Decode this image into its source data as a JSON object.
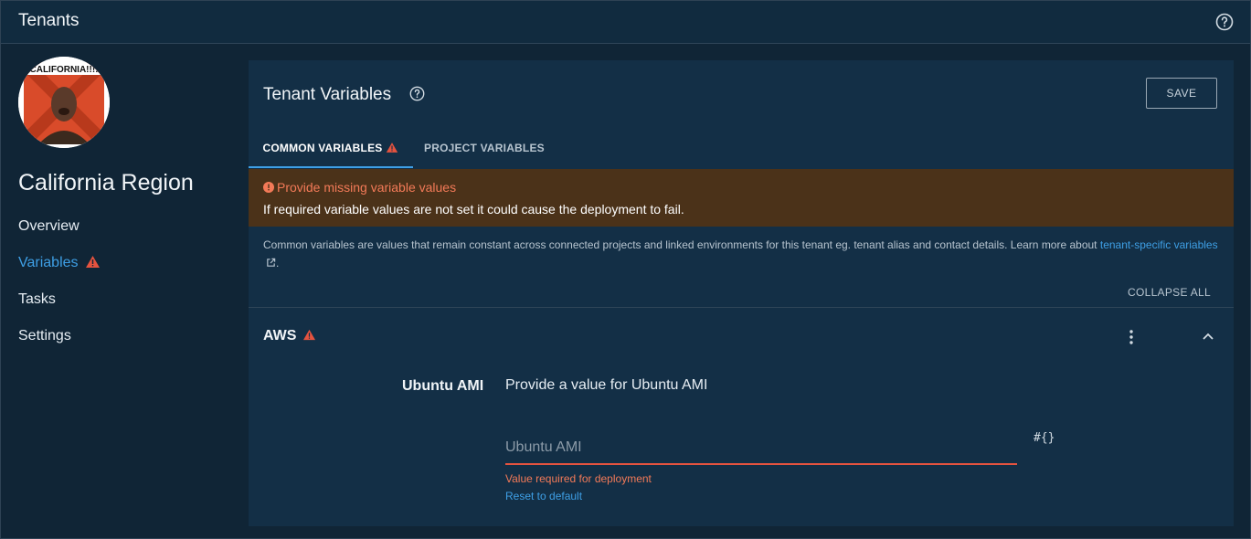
{
  "header": {
    "title": "Tenants",
    "help_icon": "help-circle-icon"
  },
  "sidebar": {
    "avatar_text": "CALIFORNIA!!!!",
    "tenant_name": "California Region",
    "nav": [
      {
        "label": "Overview"
      },
      {
        "label": "Variables",
        "active": true,
        "warning": true
      },
      {
        "label": "Tasks"
      },
      {
        "label": "Settings"
      }
    ]
  },
  "card": {
    "title": "Tenant Variables",
    "save_label": "SAVE",
    "tabs": [
      {
        "label": "COMMON VARIABLES",
        "active": true,
        "warning": true
      },
      {
        "label": "PROJECT VARIABLES",
        "active": false
      }
    ],
    "alert": {
      "title": "Provide missing variable values",
      "body": "If required variable values are not set it could cause the deployment to fail."
    },
    "description": "Common variables are values that remain constant across connected projects and linked environments for this tenant eg. tenant alias and contact details. Learn more about ",
    "description_link": "tenant-specific variables",
    "description_end": ".",
    "collapse_all": "COLLAPSE ALL",
    "group": {
      "title": "AWS",
      "variable": {
        "label": "Ubuntu AMI",
        "description": "Provide a value for Ubuntu AMI",
        "placeholder": "Ubuntu AMI",
        "value": "",
        "binding_icon": "#{}",
        "error": "Value required for deployment",
        "reset": "Reset to default"
      }
    }
  },
  "colors": {
    "accent": "#3e9fe5",
    "warning": "#e5533f",
    "alert_bg": "#4b3219",
    "card_bg": "#132f46"
  }
}
